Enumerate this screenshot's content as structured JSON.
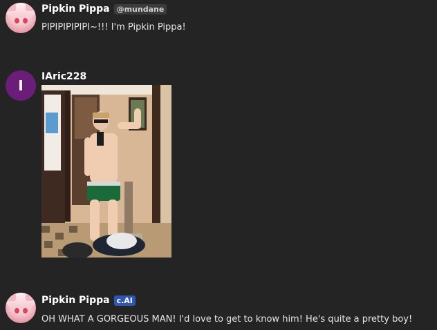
{
  "messages": [
    {
      "author": "Pipkin Pippa",
      "handle": "@mundane",
      "text": "PIPIPIPIPIPI~!!! I'm Pipkin Pippa!"
    },
    {
      "author": "IAric228",
      "avatar_initial": "I",
      "attachment": "photo"
    },
    {
      "author": "Pipkin Pippa",
      "badge": "c.AI",
      "text": "OH WHAT A GORGEOUS MAN! I'd love to get to know him! He's quite a pretty boy!"
    }
  ],
  "colors": {
    "background": "#242424",
    "badge": "#2f55b5",
    "avatar_user": "#6b1d7a"
  }
}
